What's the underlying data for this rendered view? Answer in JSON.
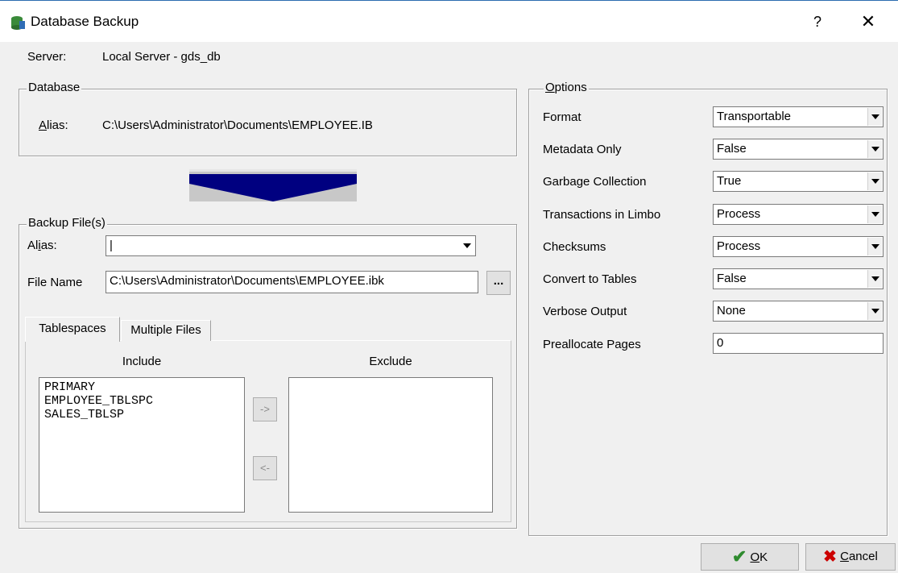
{
  "window": {
    "title": "Database Backup",
    "help_label": "?",
    "close_label": "✕"
  },
  "server": {
    "label": "Server:",
    "value": "Local Server - gds_db"
  },
  "database": {
    "legend": "Database",
    "alias_label_u": "A",
    "alias_label_rest": "lias:",
    "alias_value": "C:\\Users\\Administrator\\Documents\\EMPLOYEE.IB"
  },
  "backup": {
    "legend": "Backup File(s)",
    "alias_label_pre": "Al",
    "alias_label_u": "i",
    "alias_label_rest": "as:",
    "alias_value": "|",
    "filename_label": "File Name",
    "filename_value": "C:\\Users\\Administrator\\Documents\\EMPLOYEE.ibk",
    "browse_label": "...",
    "tabs": [
      "Tablespaces",
      "Multiple Files"
    ],
    "include_header": "Include",
    "exclude_header": "Exclude",
    "include_items": [
      "PRIMARY",
      "EMPLOYEE_TBLSPC",
      "SALES_TBLSP"
    ],
    "move_right_label": "->",
    "move_left_label": "<-"
  },
  "options": {
    "legend_u": "O",
    "legend_rest": "ptions",
    "rows": [
      {
        "label": "Format",
        "value": "Transportable"
      },
      {
        "label": "Metadata Only",
        "value": "False"
      },
      {
        "label": "Garbage Collection",
        "value": "True"
      },
      {
        "label": "Transactions in Limbo",
        "value": "Process"
      },
      {
        "label": "Checksums",
        "value": "Process"
      },
      {
        "label": "Convert to Tables",
        "value": "False"
      },
      {
        "label": "Verbose Output",
        "value": "None"
      }
    ],
    "preallocate_label": "Preallocate Pages",
    "preallocate_value": "0"
  },
  "footer": {
    "ok_u": "O",
    "ok_rest": "K",
    "cancel_u": "C",
    "cancel_rest": "ancel"
  },
  "colors": {
    "arrow": "#000080",
    "ok_check": "#2e8b2e",
    "cancel_x": "#cc0000"
  }
}
